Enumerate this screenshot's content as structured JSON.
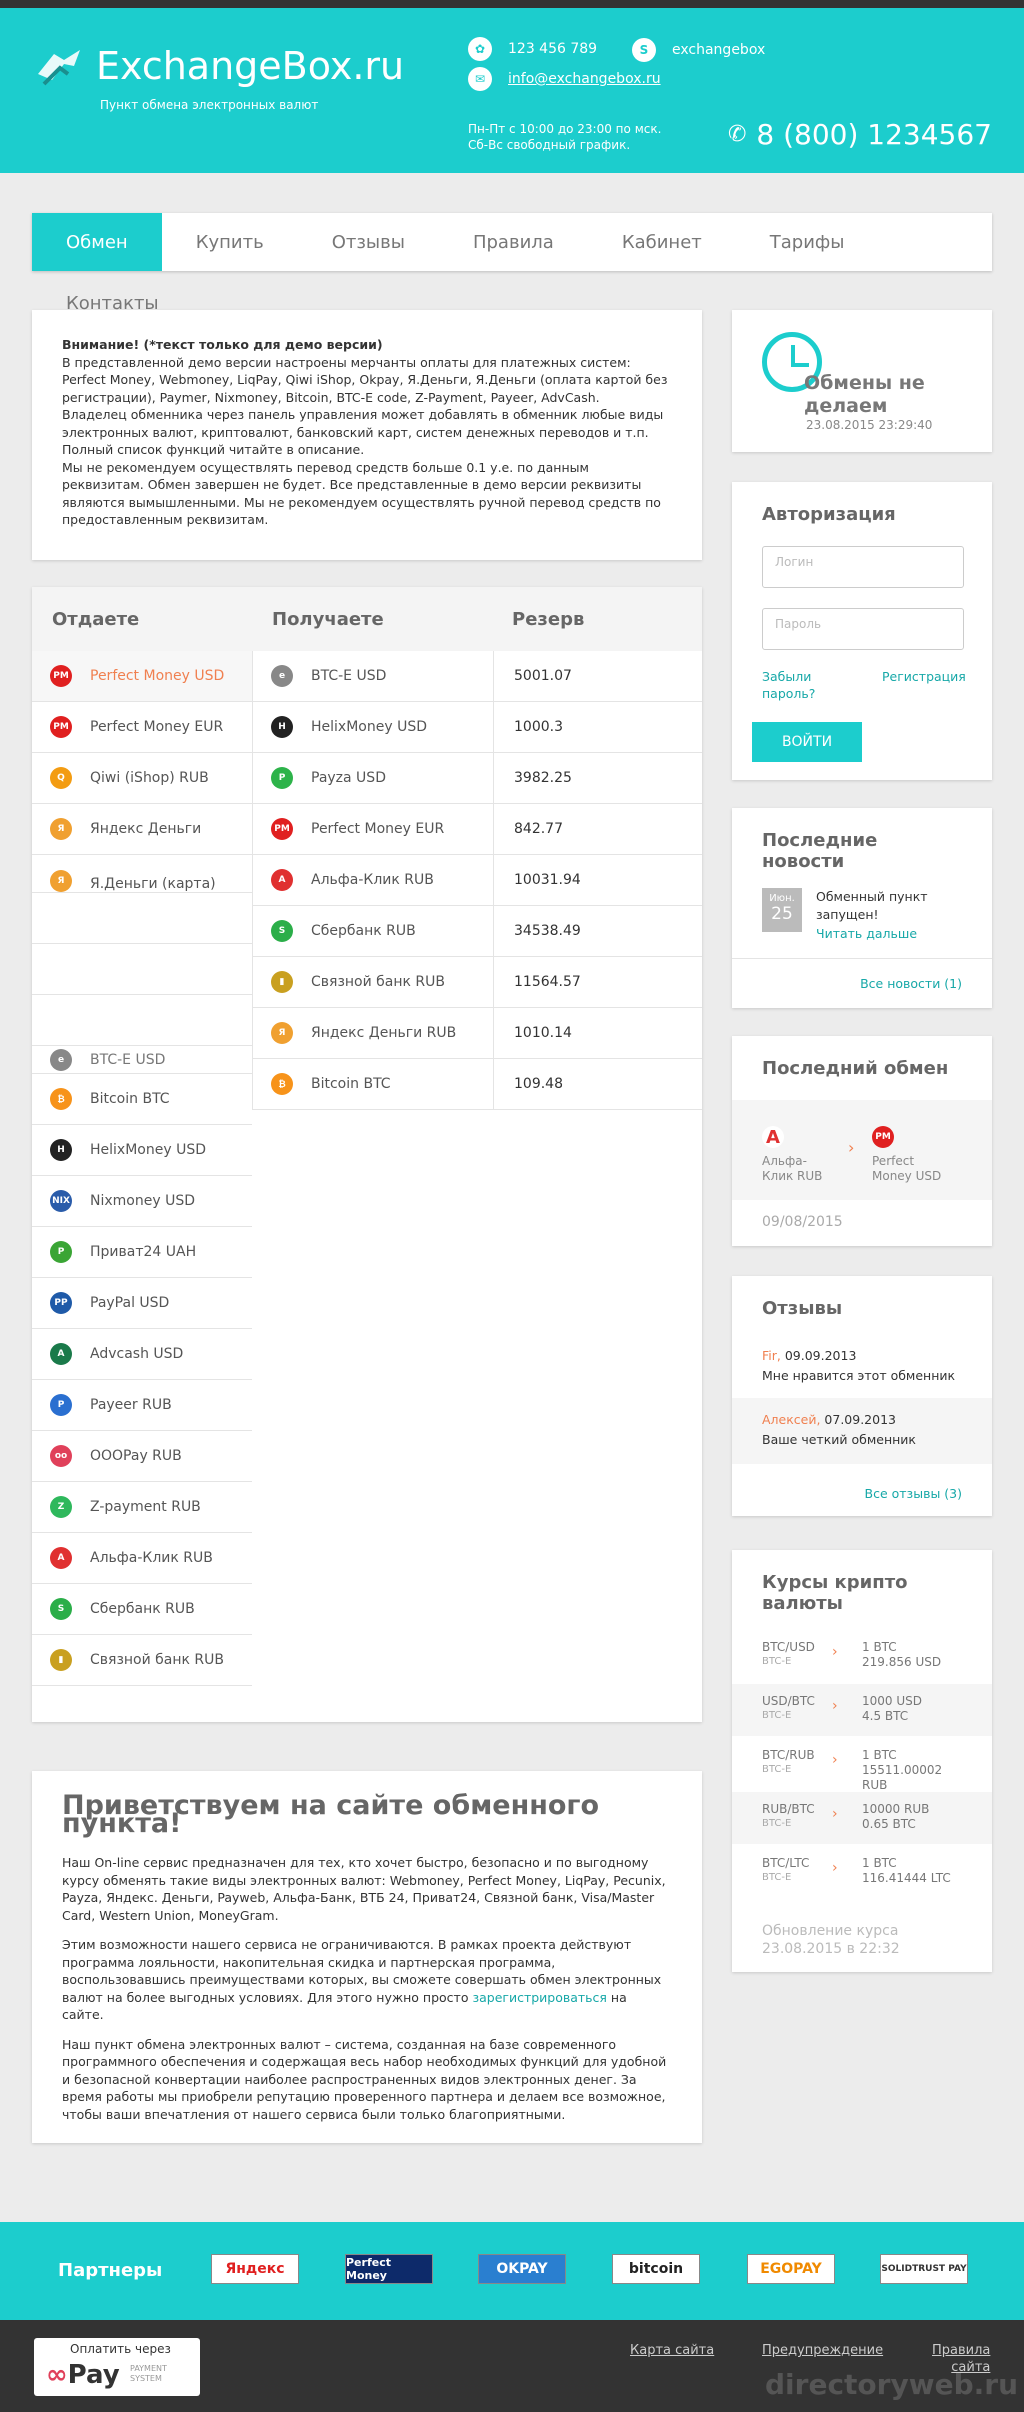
{
  "header": {
    "logo_title": "ExchangeBox.ru",
    "logo_sub": "Пункт обмена электронных валют",
    "phone_small": "123 456 789",
    "skype": "exchangebox",
    "email": "info@exchangebox.ru",
    "hours_line1": "Пн-Пт с 10:00 до 23:00 по мск.",
    "hours_line2": "Сб-Вс свободный график.",
    "phone_big": "8 (800) 1234567"
  },
  "nav": {
    "items": [
      "Обмен",
      "Купить",
      "Отзывы",
      "Правила",
      "Кабинет",
      "Тарифы"
    ],
    "extra": "Контакты"
  },
  "notice": {
    "title": "Внимание! (*текст только для демо версии)",
    "lines": [
      "В представленной демо версии настроены мерчанты оплаты для платежных систем: Perfect Money, Webmoney, LiqPay, Qiwi iShop, Okpay, Я.Деньги, Я.Деньги (оплата картой без регистрации), Paymer, Nixmoney, Bitcoin, BTC-E code, Z-Payment, Payeer, AdvCash.",
      "Владелец обменника через панель управления может добавлять в обменник любые виды электронных валют, криптовалют, банковский карт, систем денежных переводов и т.п.",
      "Полный список функций читайте в описание.",
      "Мы не рекомендуем осуществлять перевод средств больше 0.1 у.е. по данным реквизитам. Обмен завершен не будет. Все представленные в демо версии реквизиты являются вымышленными. Мы не рекомендуем осуществлять ручной перевод средств по предоставленным реквизитам."
    ]
  },
  "exchange": {
    "head_give": "Отдаете",
    "head_get": "Получаете",
    "head_reserve": "Резерв",
    "give_top": [
      {
        "label": "Perfect Money USD",
        "icon": "perfect-money-icon",
        "color": "#e02020",
        "glyph": "PM"
      },
      {
        "label": "Perfect Money EUR",
        "icon": "perfect-money-icon",
        "color": "#e02020",
        "glyph": "PM"
      },
      {
        "label": "Qiwi (iShop) RUB",
        "icon": "qiwi-icon",
        "color": "#f39c12",
        "glyph": "Q"
      },
      {
        "label": "Яндекс Деньги",
        "icon": "yandex-money-icon",
        "color": "#f0a030",
        "glyph": "Я"
      },
      {
        "label": "Я.Деньги (карта)",
        "icon": "yandex-money-icon",
        "color": "#f0a030",
        "glyph": "Я"
      }
    ],
    "give_overlap": "BTC-E USD",
    "give_bottom": [
      {
        "label": "Bitcoin BTC",
        "icon": "bitcoin-icon",
        "color": "#f7931a",
        "glyph": "₿"
      },
      {
        "label": "HelixMoney USD",
        "icon": "helixmoney-icon",
        "color": "#222222",
        "glyph": "H"
      },
      {
        "label": "Nixmoney USD",
        "icon": "nixmoney-icon",
        "color": "#2a5caa",
        "glyph": "NIX"
      },
      {
        "label": "Приват24 UAH",
        "icon": "privat24-icon",
        "color": "#3aa535",
        "glyph": "P"
      },
      {
        "label": "PayPal USD",
        "icon": "paypal-icon",
        "color": "#1f5aa8",
        "glyph": "PP"
      },
      {
        "label": "Advcash USD",
        "icon": "advcash-icon",
        "color": "#1a7a4a",
        "glyph": "A"
      },
      {
        "label": "Payeer RUB",
        "icon": "payeer-icon",
        "color": "#2a6fd0",
        "glyph": "P"
      },
      {
        "label": "OOOPay RUB",
        "icon": "ooopay-icon",
        "color": "#e0405a",
        "glyph": "oo"
      },
      {
        "label": "Z-payment RUB",
        "icon": "z-payment-icon",
        "color": "#2eb85c",
        "glyph": "Z"
      },
      {
        "label": "Альфа-Клик RUB",
        "icon": "alfa-click-icon",
        "color": "#e03030",
        "glyph": "А"
      },
      {
        "label": "Сбербанк RUB",
        "icon": "sberbank-icon",
        "color": "#2bae49",
        "glyph": "S"
      },
      {
        "label": "Связной банк RUB",
        "icon": "svyaznoy-icon",
        "color": "#c9a020",
        "glyph": "▮"
      }
    ],
    "get": [
      {
        "label": "BTC-E USD",
        "icon": "btc-e-icon",
        "color": "#888888",
        "glyph": "e",
        "reserve": "5001.07"
      },
      {
        "label": "HelixMoney USD",
        "icon": "helixmoney-icon",
        "color": "#222222",
        "glyph": "H",
        "reserve": "1000.3"
      },
      {
        "label": "Payza USD",
        "icon": "payza-icon",
        "color": "#2db34a",
        "glyph": "P",
        "reserve": "3982.25"
      },
      {
        "label": "Perfect Money EUR",
        "icon": "perfect-money-icon",
        "color": "#e02020",
        "glyph": "PM",
        "reserve": "842.77"
      },
      {
        "label": "Альфа-Клик RUB",
        "icon": "alfa-click-icon",
        "color": "#e03030",
        "glyph": "А",
        "reserve": "10031.94"
      },
      {
        "label": "Сбербанк RUB",
        "icon": "sberbank-icon",
        "color": "#2bae49",
        "glyph": "S",
        "reserve": "34538.49"
      },
      {
        "label": "Связной банк RUB",
        "icon": "svyaznoy-icon",
        "color": "#c9a020",
        "glyph": "▮",
        "reserve": "11564.57"
      },
      {
        "label": "Яндекс Деньги RUB",
        "icon": "yandex-money-icon",
        "color": "#f0a030",
        "glyph": "Я",
        "reserve": "1010.14"
      },
      {
        "label": "Bitcoin BTC",
        "icon": "bitcoin-icon",
        "color": "#f7931a",
        "glyph": "₿",
        "reserve": "109.48"
      }
    ]
  },
  "welcome": {
    "title": "Приветствуем на сайте обменного пункта!",
    "p1": "Наш On-line сервис предназначен для тех, кто хочет быстро, безопасно и по выгодному курсу обменять такие виды электронных валют: Webmoney, Perfect Money, LiqPay, Pecunix, Payza, Яндекс. Деньги, Payweb, Альфа-Банк, ВТБ 24, Приват24, Связной банк, Visa/Master Card, Western Union, MoneyGram.",
    "p2_start": "Этим возможности нашего сервиса не ограничиваются. В рамках проекта действуют программа лояльности, накопительная скидка и партнерская программа, воспользовавшись преимуществами которых, вы сможете совершать обмен электронных валют на более выгодных условиях. Для этого нужно просто ",
    "p2_link": "зарегистрироваться",
    "p2_end": " на сайте.",
    "p3": "Наш пункт обмена электронных валют – система, созданная на базе современного программного обеспечения и содержащая весь набор необходимых функций для удобной и безопасной конвертации наиболее распространенных видов электронных денег. За время работы мы приобрели репутацию проверенного партнера и делаем все возможное, чтобы ваши впечатления от нашего сервиса были только благоприятными."
  },
  "sidebar": {
    "timer_text1": "Обмены не",
    "timer_text2": "делаем",
    "timer_date": "23.08.2015 23:29:40",
    "auth_title": "Авторизация",
    "login_placeholder": "Логин",
    "password_placeholder": "Пароль",
    "forgot_line1": "Забыли",
    "forgot_line2": "пароль?",
    "register": "Регистрация",
    "login_button": "ВОЙТИ",
    "news_title_1": "Последние",
    "news_title_2": "новости",
    "news_month": "Июн.",
    "news_day": "25",
    "news_text_1": "Обменный пункт",
    "news_text_2": "запущен!",
    "news_more": "Читать дальше",
    "news_all": "Все новости (1)",
    "last_title": "Последний обмен",
    "last_from_1": "Альфа-",
    "last_from_2": "Клик RUB",
    "last_to_1": "Perfect",
    "last_to_2": "Money USD",
    "last_date": "09/08/2015",
    "reviews_title": "Отзывы",
    "rev1_name": "Fir,",
    "rev1_date": " 09.09.2013",
    "rev1_text": "Мне нравится этот обменник ..",
    "rev2_name": "Алексей,",
    "rev2_date": " 07.09.2013",
    "rev2_text": "Ваше четкий обменник",
    "reviews_all": "Все отзывы (3)",
    "crypto_title_1": "Курсы крипто",
    "crypto_title_2": "валюты",
    "crypto": [
      {
        "pair": "BTC/USD",
        "src": "BTC-E",
        "v1": "1 BTC",
        "v2": "219.856 USD",
        "v3": ""
      },
      {
        "pair": "USD/BTC",
        "src": "BTC-E",
        "v1": "1000 USD",
        "v2": "4.5 BTC",
        "v3": ""
      },
      {
        "pair": "BTC/RUB",
        "src": "BTC-E",
        "v1": "1 BTC",
        "v2": "15511.00002",
        "v3": "RUB"
      },
      {
        "pair": "RUB/BTC",
        "src": "BTC-E",
        "v1": "10000 RUB",
        "v2": "0.65 BTC",
        "v3": ""
      },
      {
        "pair": "BTC/LTC",
        "src": "BTC-E",
        "v1": "1 BTC",
        "v2": "116.41444 LTC",
        "v3": ""
      }
    ],
    "update_1": "Обновление курса",
    "update_2": "23.08.2015 в 22:32"
  },
  "partners": {
    "label": "Партнеры",
    "logos": [
      "Яндекс",
      "Perfect Money",
      "OKPAY",
      "bitcoin",
      "EGOPAY",
      "SOLIDTRUST PAY"
    ]
  },
  "footer": {
    "pay_line1": "Оплатить через",
    "pay_line2": "Pay",
    "pay_line3a": "PAYMENT",
    "pay_line3b": "SYSTEM",
    "link1": "Карта сайта",
    "link2": "Предупреждение",
    "link3a": "Правила",
    "link3b": "сайта",
    "watermark": "directoryweb.ru"
  }
}
